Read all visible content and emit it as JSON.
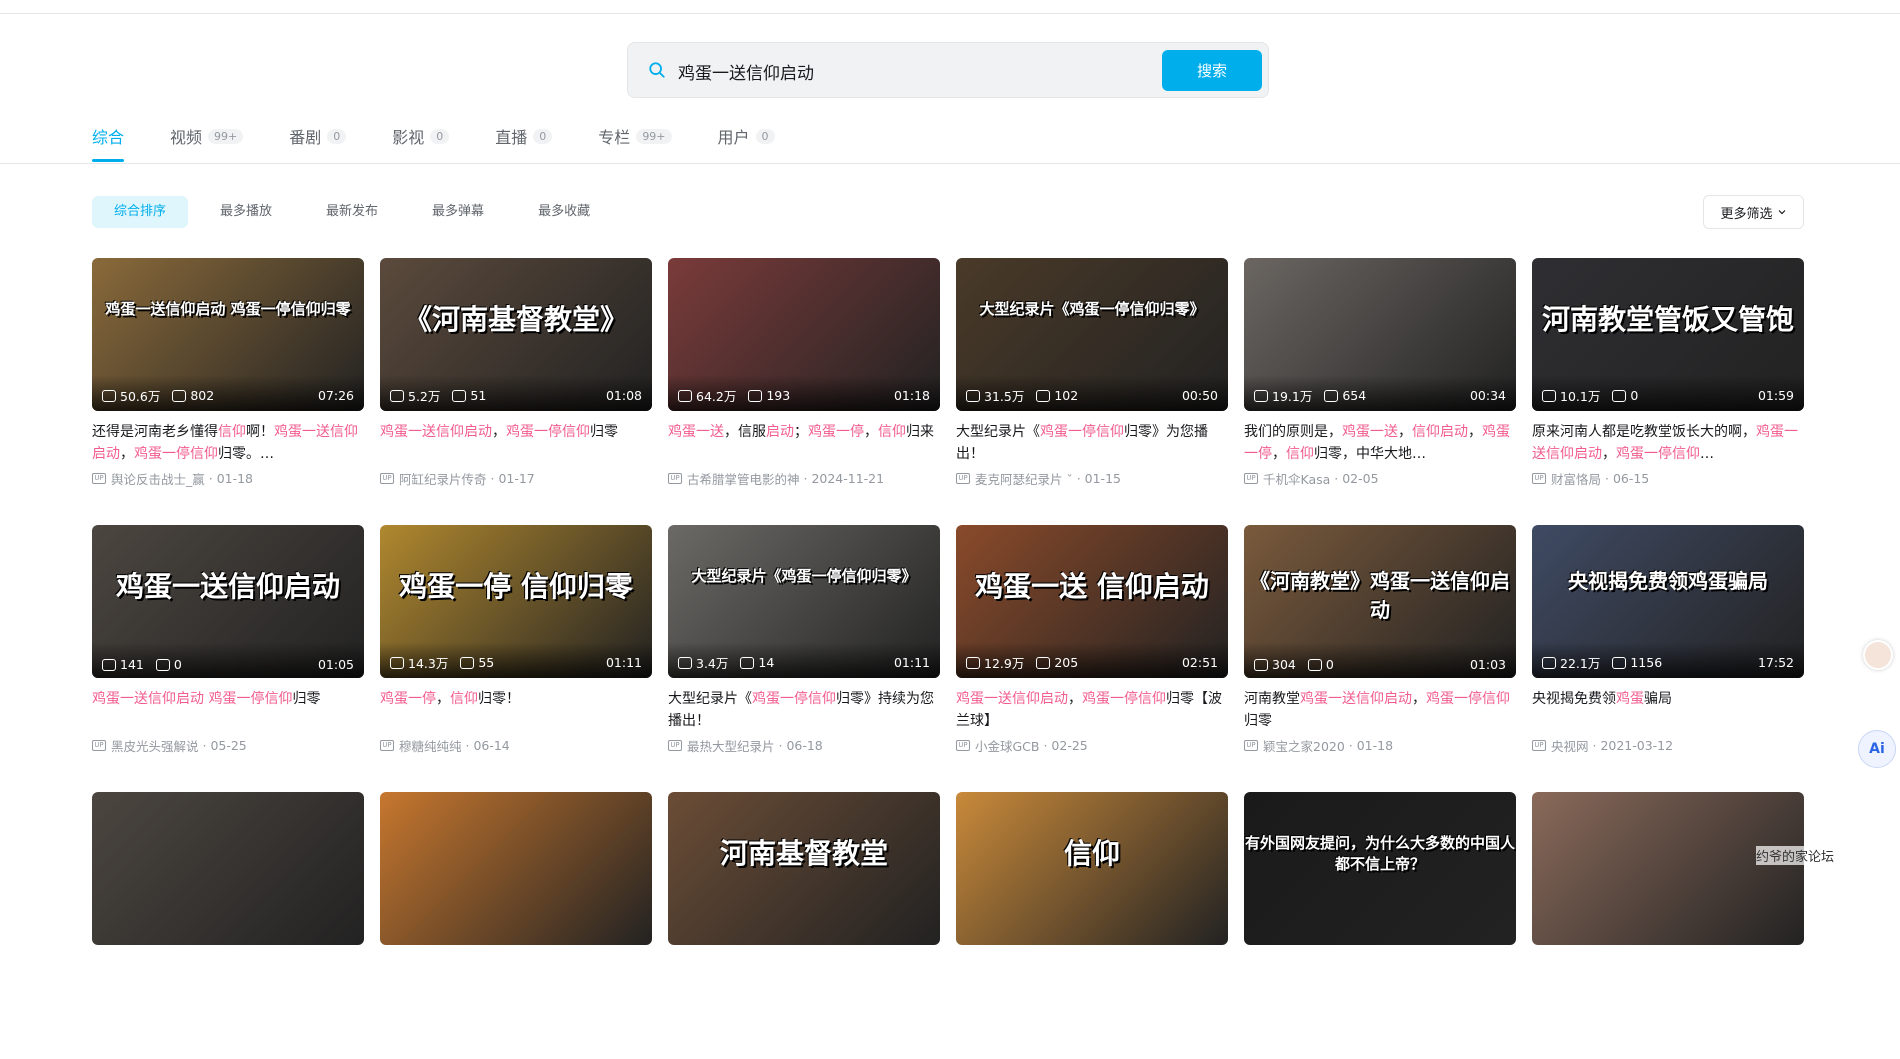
{
  "search": {
    "query": "鸡蛋一送信仰启动",
    "button": "搜索"
  },
  "tabs": [
    {
      "label": "综合",
      "count": ""
    },
    {
      "label": "视频",
      "count": "99+"
    },
    {
      "label": "番剧",
      "count": "0"
    },
    {
      "label": "影视",
      "count": "0"
    },
    {
      "label": "直播",
      "count": "0"
    },
    {
      "label": "专栏",
      "count": "99+"
    },
    {
      "label": "用户",
      "count": "0"
    }
  ],
  "sorts": [
    "综合排序",
    "最多播放",
    "最新发布",
    "最多弹幕",
    "最多收藏"
  ],
  "more_filter": "更多筛选",
  "videos": [
    {
      "caption": "鸡蛋一送信仰启动 鸡蛋一停信仰归零",
      "bg": "#8a6a3a",
      "plays": "50.6万",
      "danmaku": "802",
      "duration": "07:26",
      "title": "还得是河南老乡懂得信仰啊！鸡蛋一送信仰启动，鸡蛋一停信仰归零。…",
      "author": "舆论反击战士_赢",
      "date": "01-18"
    },
    {
      "caption": "《河南基督教堂》",
      "bg": "#5b4a3c",
      "plays": "5.2万",
      "danmaku": "51",
      "duration": "01:08",
      "title": "鸡蛋一送信仰启动，鸡蛋一停信仰归零",
      "author": "阿缸纪录片传奇",
      "date": "01-17"
    },
    {
      "caption": "",
      "bg": "#7a3b3a",
      "plays": "64.2万",
      "danmaku": "193",
      "duration": "01:18",
      "title": "鸡蛋一送，信服启动；鸡蛋一停，信仰归来",
      "author": "古希腊掌管电影的神",
      "date": "2024-11-21"
    },
    {
      "caption": "大型纪录片《鸡蛋一停信仰归零》",
      "bg": "#4a3a28",
      "plays": "31.5万",
      "danmaku": "102",
      "duration": "00:50",
      "title": "大型纪录片《鸡蛋一停信仰归零》为您播出！",
      "author": "麦克阿瑟纪录片 ˇ",
      "date": "01-15"
    },
    {
      "caption": "",
      "bg": "#6b6662",
      "plays": "19.1万",
      "danmaku": "654",
      "duration": "00:34",
      "title": "我们的原则是，鸡蛋一送，信仰启动，鸡蛋一停，信仰归零，中华大地…",
      "author": "千机伞Kasa",
      "date": "02-05"
    },
    {
      "caption": "河南教堂管饭又管饱",
      "bg": "#2f2f33",
      "plays": "10.1万",
      "danmaku": "0",
      "duration": "01:59",
      "title": "原来河南人都是吃教堂饭长大的啊，鸡蛋一送信仰启动，鸡蛋一停信仰…",
      "author": "财富恪局",
      "date": "06-15"
    },
    {
      "caption": "鸡蛋一送信仰启动",
      "bg": "#4c4640",
      "plays": "141",
      "danmaku": "0",
      "duration": "01:05",
      "title": "鸡蛋一送信仰启动 鸡蛋一停信仰归零",
      "author": "黑皮光头强解说",
      "date": "05-25"
    },
    {
      "caption": "鸡蛋一停 信仰归零",
      "bg": "#b0882e",
      "plays": "14.3万",
      "danmaku": "55",
      "duration": "01:11",
      "title": "鸡蛋一停，信仰归零！",
      "author": "穆糖纯纯纯",
      "date": "06-14"
    },
    {
      "caption": "大型纪录片《鸡蛋一停信仰归零》",
      "bg": "#6c6a66",
      "plays": "3.4万",
      "danmaku": "14",
      "duration": "01:11",
      "title": "大型纪录片《鸡蛋一停信仰归零》持续为您播出！",
      "author": "最热大型纪录片",
      "date": "06-18"
    },
    {
      "caption": "鸡蛋一送 信仰启动",
      "bg": "#8a4a2a",
      "plays": "12.9万",
      "danmaku": "205",
      "duration": "02:51",
      "title": "鸡蛋一送信仰启动，鸡蛋一停信仰归零【波兰球】",
      "author": "小金球GCB",
      "date": "02-25"
    },
    {
      "caption": "《河南教堂》鸡蛋一送信仰启动",
      "bg": "#7a5a3c",
      "plays": "304",
      "danmaku": "0",
      "duration": "01:03",
      "title": "河南教堂鸡蛋一送信仰启动，鸡蛋一停信仰归零",
      "author": "颖宝之家2020",
      "date": "01-18"
    },
    {
      "caption": "央视揭免费领鸡蛋骗局",
      "bg": "#3f4a63",
      "plays": "22.1万",
      "danmaku": "1156",
      "duration": "17:52",
      "title": "央视揭免费领鸡蛋骗局",
      "author": "央视网",
      "date": "2021-03-12"
    },
    {
      "caption": "",
      "bg": "#4c4640",
      "plays": "",
      "danmaku": "",
      "duration": "",
      "title": "",
      "author": "",
      "date": ""
    },
    {
      "caption": "",
      "bg": "#c7772e",
      "plays": "",
      "danmaku": "",
      "duration": "",
      "title": "",
      "author": "",
      "date": ""
    },
    {
      "caption": "河南基督教堂",
      "bg": "#6b4d36",
      "plays": "",
      "danmaku": "",
      "duration": "",
      "title": "",
      "author": "",
      "date": ""
    },
    {
      "caption": "信仰",
      "bg": "#c98a3a",
      "plays": "",
      "danmaku": "",
      "duration": "",
      "title": "",
      "author": "",
      "date": ""
    },
    {
      "caption": "有外国网友提问，为什么大多数的中国人都不信上帝？",
      "bg": "#1a1a1a",
      "plays": "",
      "danmaku": "",
      "duration": "",
      "title": "",
      "author": "",
      "date": ""
    },
    {
      "caption": "",
      "bg": "#8a6a5a",
      "plays": "",
      "danmaku": "",
      "duration": "",
      "title": "",
      "author": "",
      "date": ""
    }
  ],
  "ai_button": "Ai",
  "watermark": "约爷的家论坛"
}
